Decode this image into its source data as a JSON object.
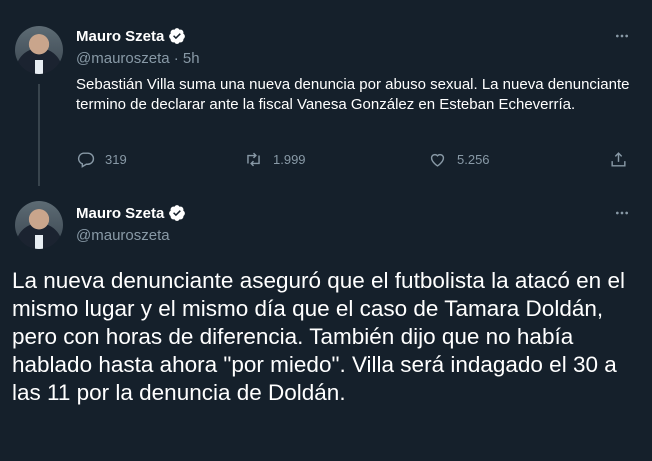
{
  "tweet1": {
    "author_name": "Mauro Szeta",
    "author_handle": "@mauroszeta · 5h",
    "text": "Sebastián Villa suma una nueva denuncia por abuso sexual. La nueva denunciante termino de declarar ante la fiscal Vanesa González en Esteban Echeverría.",
    "reply_count": "319",
    "retweet_count": "1.999",
    "like_count": "5.256"
  },
  "tweet2": {
    "author_name": "Mauro Szeta",
    "author_handle": "@mauroszeta",
    "text": "La nueva denunciante aseguró que el futbolista la atacó en el mismo lugar y el mismo día que el caso de Tamara Doldán, pero con horas de diferencia. También dijo que no había hablado hasta ahora \"por miedo\". Villa será indagado el 30 a las 11 por la denuncia de Doldán."
  },
  "colors": {
    "background": "#15202b",
    "text": "#ffffff",
    "secondary": "#8899a6",
    "verified": "#ffffff",
    "thread_line": "#38444d"
  },
  "icons": [
    "verified-badge-icon",
    "more-icon",
    "reply-icon",
    "retweet-icon",
    "like-icon",
    "share-icon"
  ]
}
